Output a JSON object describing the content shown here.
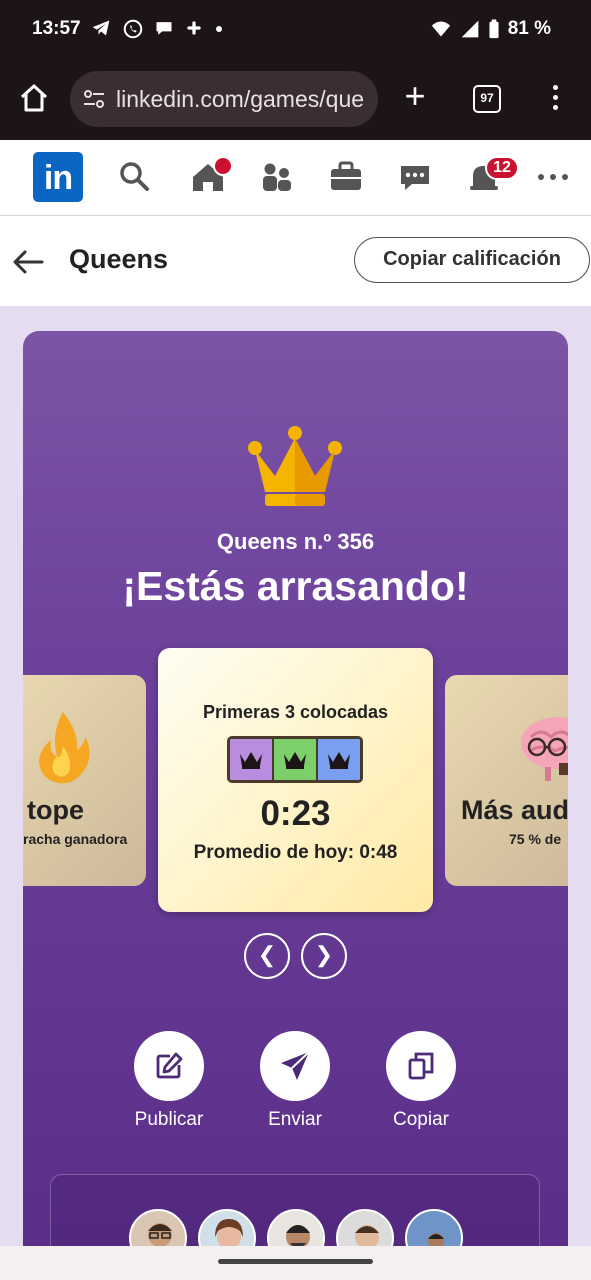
{
  "status_bar": {
    "time": "13:57",
    "battery": "81 %"
  },
  "browser": {
    "url": "linkedin.com/games/que",
    "tab_count": "97"
  },
  "linkedin_nav": {
    "logo": "in",
    "notifications_badge": "12"
  },
  "page_header": {
    "title": "Queens",
    "copy_score_label": "Copiar calificación"
  },
  "result": {
    "game_number": "Queens n.º 356",
    "headline": "¡Estás arrasando!"
  },
  "cards": {
    "left": {
      "title": "tope",
      "subtitle": "racha ganadora"
    },
    "center": {
      "title": "Primeras 3 colocadas",
      "time": "0:23",
      "average": "Promedio de hoy: 0:48"
    },
    "right": {
      "title": "Más aud",
      "subtitle": "75 % de"
    }
  },
  "pager": {
    "prev": "❮",
    "next": "❯"
  },
  "actions": {
    "post": "Publicar",
    "send": "Enviar",
    "copy": "Copiar"
  },
  "colors": {
    "linkedin_blue": "#0a66c2",
    "notification_red": "#cb112d",
    "card_purple": "#6a3f9a",
    "crown_gold": "#f5b400",
    "queen_cell_purple": "#b88de0",
    "queen_cell_green": "#7ccf6a",
    "queen_cell_blue": "#7a9ef0"
  }
}
